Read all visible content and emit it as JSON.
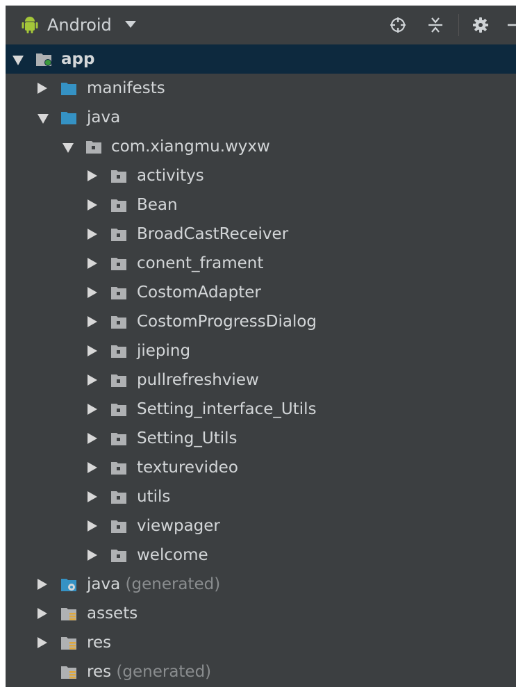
{
  "toolbar": {
    "view_mode": "Android",
    "icons": [
      "android-icon",
      "dropdown-caret-icon",
      "crosshair-icon",
      "collapse-all-icon",
      "gear-icon",
      "hide-icon"
    ],
    "colors": {
      "panel_bg": "#3c3f41",
      "selection_bg": "#0d293e",
      "folder_blue": "#3592c4",
      "text": "#d3d6d8",
      "muted": "#8a8d8f"
    }
  },
  "tree": {
    "root": {
      "label": "app",
      "expanded": true,
      "selected": true
    },
    "manifests": {
      "label": "manifests",
      "expanded": false
    },
    "java": {
      "label": "java",
      "expanded": true
    },
    "package": {
      "label": "com.xiangmu.wyxw",
      "expanded": true
    },
    "packages": [
      {
        "label": "activitys"
      },
      {
        "label": "Bean"
      },
      {
        "label": "BroadCastReceiver"
      },
      {
        "label": "conent_frament"
      },
      {
        "label": "CostomAdapter"
      },
      {
        "label": "CostomProgressDialog"
      },
      {
        "label": "jieping"
      },
      {
        "label": "pullrefreshview"
      },
      {
        "label": "Setting_interface_Utils"
      },
      {
        "label": "Setting_Utils"
      },
      {
        "label": "texturevideo"
      },
      {
        "label": "utils"
      },
      {
        "label": "viewpager"
      },
      {
        "label": "welcome"
      }
    ],
    "java_generated": {
      "label": "java",
      "suffix": "(generated)"
    },
    "assets": {
      "label": "assets"
    },
    "res": {
      "label": "res"
    },
    "res_generated": {
      "label": "res",
      "suffix": "(generated)"
    }
  }
}
